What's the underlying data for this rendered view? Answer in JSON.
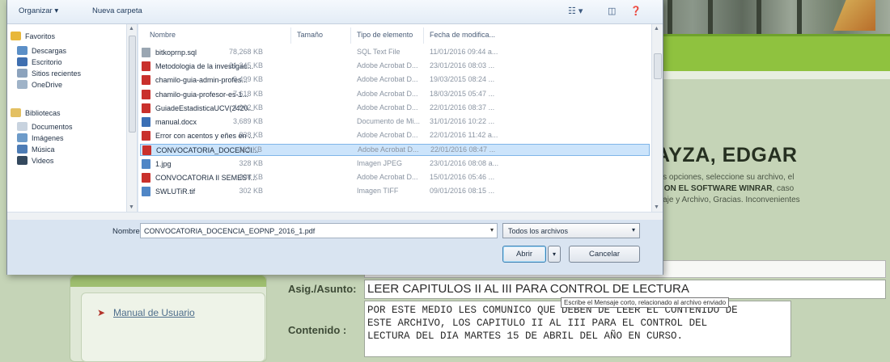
{
  "background": {
    "name_heading": "AYZA, EDGAR",
    "note_line1": "e las opciones, seleccione su archivo, el",
    "note_line2": "O CON EL SOFTWARE WINRAR",
    "note_line2_suffix": ", caso",
    "note_line3": "ensaje y Archivo, Gracias. Inconvenientes",
    "manual_link": "Manual de Usuario",
    "asig_label": "Asig./Asunto:",
    "asig_value": "LEER CAPITULOS II AL III PARA CONTROL DE LECTURA",
    "content_label": "Contenido :",
    "content_value": "POR ESTE MEDIO LES COMUNICO QUE DEBEN DE LEER EL CONTENIDO DE\nESTE ARCHIVO, LOS CAPITULO II AL III PARA EL CONTROL DEL\nLECTURA DEL DIA MARTES 15 DE ABRIL DEL AÑO EN CURSO.",
    "tooltip": "Escribe el Mensaje corto, relacionado al archivo enviado"
  },
  "dialog": {
    "toolbar": {
      "organizar": "Organizar ▾",
      "nueva_carpeta": "Nueva carpeta"
    },
    "nav": [
      {
        "label": "Favoritos",
        "icon": "star-icon",
        "color": "#e8b73a"
      },
      {
        "label": "Descargas",
        "icon": "downloads-folder-icon",
        "color": "#5b8fc7"
      },
      {
        "label": "Escritorio",
        "icon": "desktop-icon",
        "color": "#3f6fb0"
      },
      {
        "label": "Sitios recientes",
        "icon": "recent-places-icon",
        "color": "#8ca3bd"
      },
      {
        "label": "OneDrive",
        "icon": "onedrive-icon",
        "color": "#9fb3c8"
      },
      {
        "label": "Bibliotecas",
        "icon": "libraries-icon",
        "color": "#e3c063"
      },
      {
        "label": "Documentos",
        "icon": "documents-icon",
        "color": "#c8d3df"
      },
      {
        "label": "Imágenes",
        "icon": "pictures-icon",
        "color": "#6d9bc9"
      },
      {
        "label": "Música",
        "icon": "music-icon",
        "color": "#4d7cb5"
      },
      {
        "label": "Videos",
        "icon": "videos-icon",
        "color": "#34495e"
      }
    ],
    "columns": {
      "name": "Nombre",
      "size": "Tamaño",
      "type": "Tipo de elemento",
      "date": "Fecha de modifica..."
    },
    "files": [
      {
        "name": "bitkoprnp.sql",
        "size": "78,268 KB",
        "type": "SQL Text File",
        "date": "11/01/2016 09:44 a...",
        "icon": "sql-file-icon",
        "color": "#9aa6b2"
      },
      {
        "name": "Metodologia de la investigac...",
        "size": "21,245 KB",
        "type": "Adobe Acrobat D...",
        "date": "23/01/2016 08:03 ...",
        "icon": "pdf-icon",
        "color": "#c9302c"
      },
      {
        "name": "chamilo-guia-admin-profes...",
        "size": "9,499 KB",
        "type": "Adobe Acrobat D...",
        "date": "19/03/2015 08:24 ...",
        "icon": "pdf-icon",
        "color": "#c9302c"
      },
      {
        "name": "chamilo-guia-profesor-es-1...",
        "size": "7,618 KB",
        "type": "Adobe Acrobat D...",
        "date": "18/03/2015 05:47 ...",
        "icon": "pdf-icon",
        "color": "#c9302c"
      },
      {
        "name": "GuiadeEstadisticaUCV(2420...",
        "size": "4,902 KB",
        "type": "Adobe Acrobat D...",
        "date": "22/01/2016 08:37 ...",
        "icon": "pdf-icon",
        "color": "#c9302c"
      },
      {
        "name": "manual.docx",
        "size": "3,689 KB",
        "type": "Documento de Mi...",
        "date": "31/01/2016 10:22 ...",
        "icon": "word-doc-icon",
        "color": "#3b6fb5"
      },
      {
        "name": "Error con acentos y eñes en ...",
        "size": "838 KB",
        "type": "Adobe Acrobat D...",
        "date": "22/01/2016 11:42 a...",
        "icon": "pdf-icon",
        "color": "#c9302c"
      },
      {
        "name": "CONVOCATORIA_DOCENCI...",
        "size": "363 KB",
        "type": "Adobe Acrobat D...",
        "date": "22/01/2016 08:47 ...",
        "icon": "pdf-icon",
        "color": "#c9302c",
        "selected": true
      },
      {
        "name": "1.jpg",
        "size": "328 KB",
        "type": "Imagen JPEG",
        "date": "23/01/2016 08:08 a...",
        "icon": "image-file-icon",
        "color": "#4f86c6"
      },
      {
        "name": "CONVOCATORIA II SEMEST...",
        "size": "304 KB",
        "type": "Adobe Acrobat D...",
        "date": "15/01/2016 05:46 ...",
        "icon": "pdf-icon",
        "color": "#c9302c"
      },
      {
        "name": "SWLUTiR.tif",
        "size": "302 KB",
        "type": "Imagen TIFF",
        "date": "09/01/2016 08:15 ...",
        "icon": "image-file-icon",
        "color": "#4f86c6"
      }
    ],
    "filename_label": "Nombre:",
    "filename_value": "CONVOCATORIA_DOCENCIA_EOPNP_2016_1.pdf",
    "filetype_value": "Todos los archivos",
    "open_button": "Abrir",
    "cancel_button": "Cancelar"
  }
}
